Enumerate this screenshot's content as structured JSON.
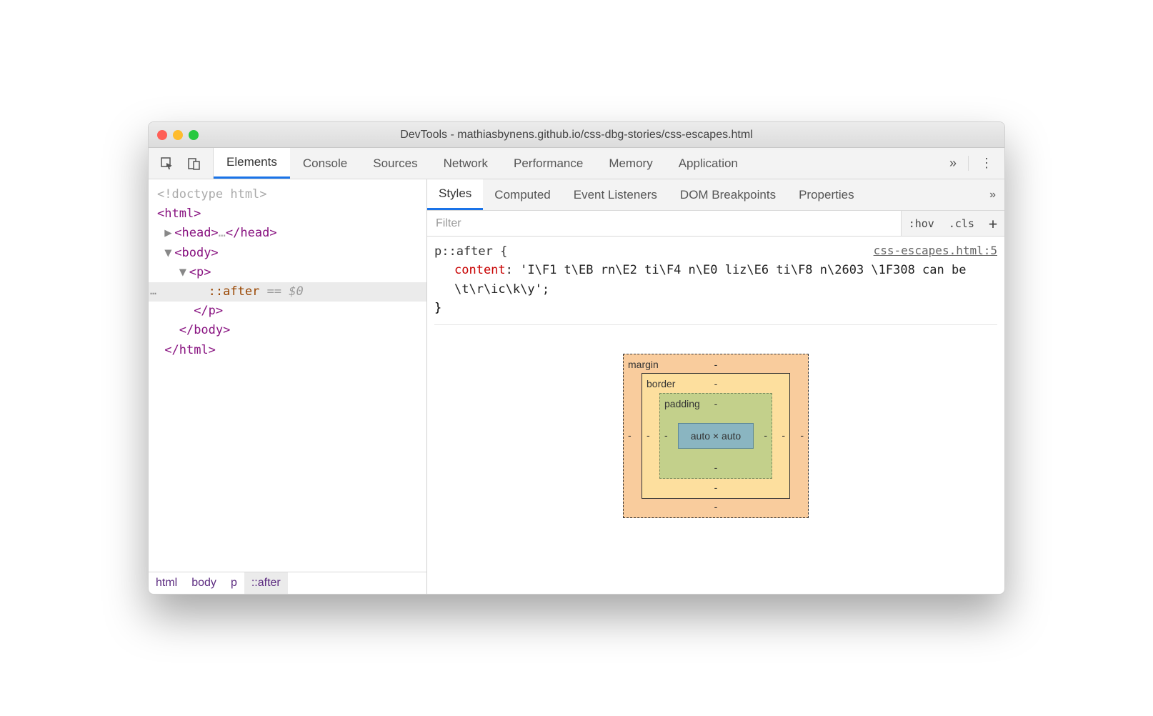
{
  "window": {
    "title": "DevTools - mathiasbynens.github.io/css-dbg-stories/css-escapes.html"
  },
  "mainTabs": [
    "Elements",
    "Console",
    "Sources",
    "Network",
    "Performance",
    "Memory",
    "Application"
  ],
  "mainTabActive": 0,
  "dom": {
    "doctype": "<!doctype html>",
    "htmlOpen": "<html>",
    "headOpen": "<head>",
    "headEllipsis": "…",
    "headClose": "</head>",
    "bodyOpen": "<body>",
    "pOpen": "<p>",
    "pseudo": "::after",
    "eq": "== $0",
    "pClose": "</p>",
    "bodyClose": "</body>",
    "htmlClose": "</html>"
  },
  "crumbs": [
    "html",
    "body",
    "p",
    "::after"
  ],
  "crumbActive": 3,
  "subTabs": [
    "Styles",
    "Computed",
    "Event Listeners",
    "DOM Breakpoints",
    "Properties"
  ],
  "subTabActive": 0,
  "filter": {
    "placeholder": "Filter",
    "hov": ":hov",
    "cls": ".cls"
  },
  "rule": {
    "selector": "p::after {",
    "source": "css-escapes.html:5",
    "propName": "content",
    "propValue": "'I\\F1 t\\EB rn\\E2 ti\\F4 n\\E0 liz\\E6 ti\\F8 n\\2603 \\1F308 can be \\t\\r\\ic\\k\\y'",
    "close": "}"
  },
  "boxModel": {
    "marginLabel": "margin",
    "borderLabel": "border",
    "paddingLabel": "padding",
    "dash": "-",
    "content": "auto × auto"
  }
}
